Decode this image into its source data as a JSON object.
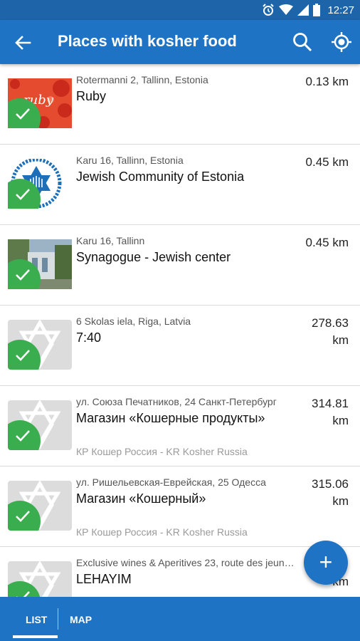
{
  "status_bar": {
    "time": "12:27",
    "icons": [
      "alarm-icon",
      "wifi-icon",
      "signal-icon",
      "battery-icon"
    ]
  },
  "app_bar": {
    "title": "Places with kosher food",
    "back_icon": "arrow-left-icon",
    "search_icon": "search-icon",
    "location_icon": "my-location-icon"
  },
  "places": [
    {
      "address": "Rotermanni 2, Tallinn, Estonia",
      "name": "Ruby",
      "distance": "0.13 km",
      "subtitle": "",
      "thumbnail": "ruby-logo",
      "badge": "check-icon"
    },
    {
      "address": "Karu 16, Tallinn, Estonia",
      "name": "Jewish Community of Estonia",
      "distance": "0.45 km",
      "subtitle": "",
      "thumbnail": "community-logo",
      "badge": "check-icon"
    },
    {
      "address": "Karu 16, Tallinn",
      "name": "Synagogue - Jewish center",
      "distance": "0.45 km",
      "subtitle": "",
      "thumbnail": "synagogue-photo",
      "badge": "check-icon"
    },
    {
      "address": "6 Skolas iela, Riga, Latvia",
      "name": "7:40",
      "distance": "278.63 km",
      "subtitle": "",
      "thumbnail": "placeholder-star",
      "badge": "check-icon"
    },
    {
      "address": "ул. Союза Печатников, 24 Санкт-Петербург",
      "name": "Магазин «Кошерные продукты»",
      "distance": "314.81 km",
      "subtitle": "КР Кошер Россия - KR Kosher Russia",
      "thumbnail": "placeholder-star",
      "badge": "check-icon"
    },
    {
      "address": "ул. Ришельевская-Еврейская, 25 Одесса",
      "name": "Магазин «Кошерный»",
      "distance": "315.06 km",
      "subtitle": "КР Кошер Россия - KR Kosher Russia",
      "thumbnail": "placeholder-star",
      "badge": "check-icon"
    },
    {
      "address": "Exclusive wines & Aperitives 23, route des jeun…",
      "name": "LEHAYIM",
      "distance": "km",
      "subtitle": "",
      "thumbnail": "placeholder-star",
      "badge": "check-icon"
    }
  ],
  "fab": {
    "label": "+"
  },
  "tabs": [
    {
      "label": "LIST",
      "selected": true
    },
    {
      "label": "MAP",
      "selected": false
    }
  ],
  "colors": {
    "primary": "#1f73c4",
    "status_bar": "#1e64a8",
    "check_green": "#3aae4f",
    "placeholder_gray": "#dcdcdc"
  }
}
